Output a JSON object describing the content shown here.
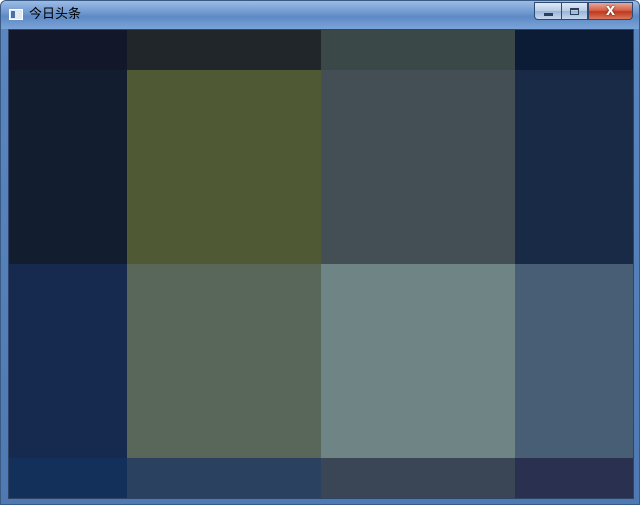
{
  "window": {
    "title": "今日头条",
    "app_icon": "window-app-icon",
    "buttons": {
      "minimize_icon": "minimize-icon",
      "maximize_icon": "maximize-icon",
      "close_label": "X",
      "close_icon": "close-icon"
    }
  },
  "content": {
    "description_type": "pixel-block-image",
    "colors": [
      [
        "#121829",
        "#202629",
        "#3a4848",
        "#0c1b36"
      ],
      [
        "#121d30",
        "#4f5933",
        "#434f55",
        "#182a45"
      ],
      [
        "#162a50",
        "#59675b",
        "#6f8585",
        "#485e74"
      ],
      [
        "#13305a",
        "#2b4160",
        "#3a4656",
        "#2a3150"
      ]
    ]
  }
}
